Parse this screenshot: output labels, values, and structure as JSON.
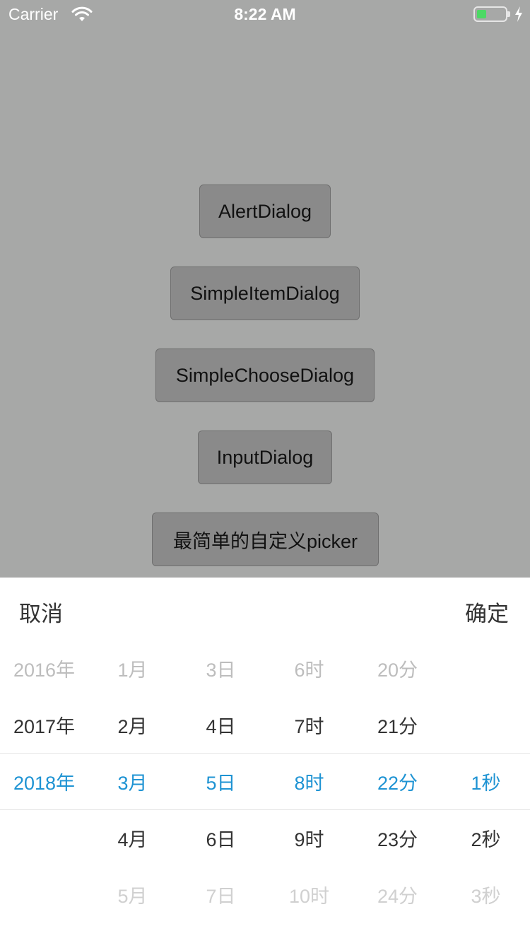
{
  "status_bar": {
    "carrier": "Carrier",
    "time": "8:22 AM",
    "battery_color": "#4cd964"
  },
  "buttons": {
    "alert": "AlertDialog",
    "simple_item": "SimpleItemDialog",
    "simple_choose": "SimpleChooseDialog",
    "input": "InputDialog",
    "custom_picker": "最简单的自定义picker"
  },
  "picker": {
    "cancel": "取消",
    "confirm": "确定",
    "selected_color": "#1e93d3",
    "columns": {
      "year": [
        "2016年",
        "2017年",
        "2018年"
      ],
      "month": [
        "1月",
        "2月",
        "3月",
        "4月",
        "5月"
      ],
      "day": [
        "3日",
        "4日",
        "5日",
        "6日",
        "7日"
      ],
      "hour": [
        "6时",
        "7时",
        "8时",
        "9时",
        "10时"
      ],
      "minute": [
        "20分",
        "21分",
        "22分",
        "23分",
        "24分"
      ],
      "second": [
        "1秒",
        "2秒",
        "3秒"
      ]
    }
  }
}
